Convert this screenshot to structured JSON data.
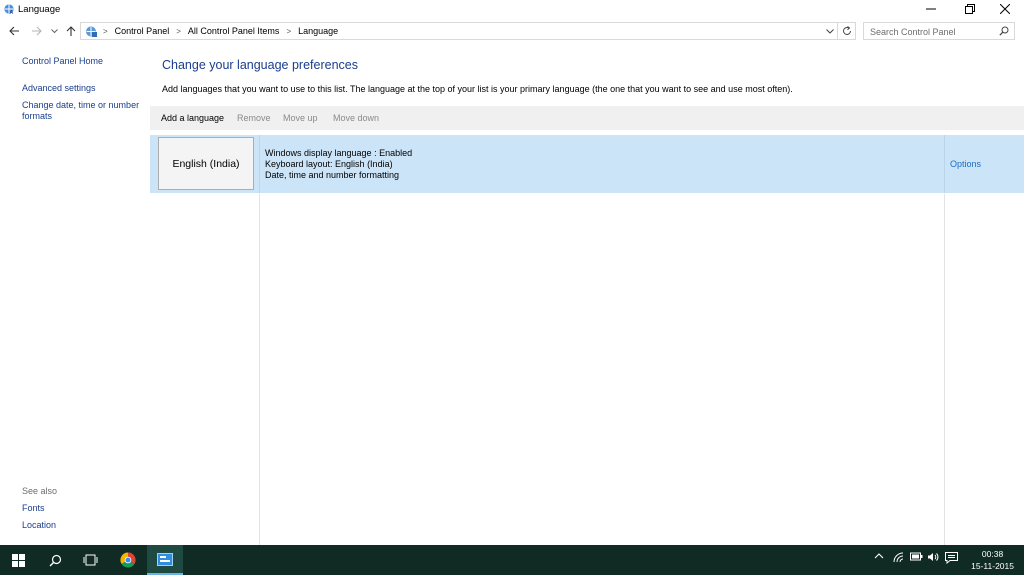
{
  "window": {
    "title": "Language"
  },
  "address": {
    "crumbs": [
      "Control Panel",
      "All Control Panel Items",
      "Language"
    ],
    "search_placeholder": "Search Control Panel"
  },
  "sidebar": {
    "home": "Control Panel Home",
    "links": [
      "Advanced settings",
      "Change date, time or number",
      "formats"
    ],
    "see_also_label": "See also",
    "see_also": [
      "Fonts",
      "Location"
    ]
  },
  "main": {
    "heading": "Change your language preferences",
    "description": "Add languages that you want to use to this list. The language at the top of your list is your primary language (the one that you want to see and use most often).",
    "toolbar": {
      "add": "Add a language",
      "remove": "Remove",
      "move_up": "Move up",
      "move_down": "Move down"
    },
    "languages": [
      {
        "name": "English (India)",
        "details": [
          "Windows display language : Enabled",
          "Keyboard layout: English (India)",
          "Date, time and number formatting"
        ],
        "options": "Options"
      }
    ]
  },
  "taskbar": {
    "time": "00:38",
    "date": "15-11-2015",
    "apps": [
      "start-icon",
      "search-icon",
      "task-view-icon",
      "chrome-icon",
      "control-panel-icon"
    ]
  },
  "colors": {
    "link": "#1a3e8c",
    "selected_row": "#cce4f7",
    "taskbar": "#102a24"
  }
}
